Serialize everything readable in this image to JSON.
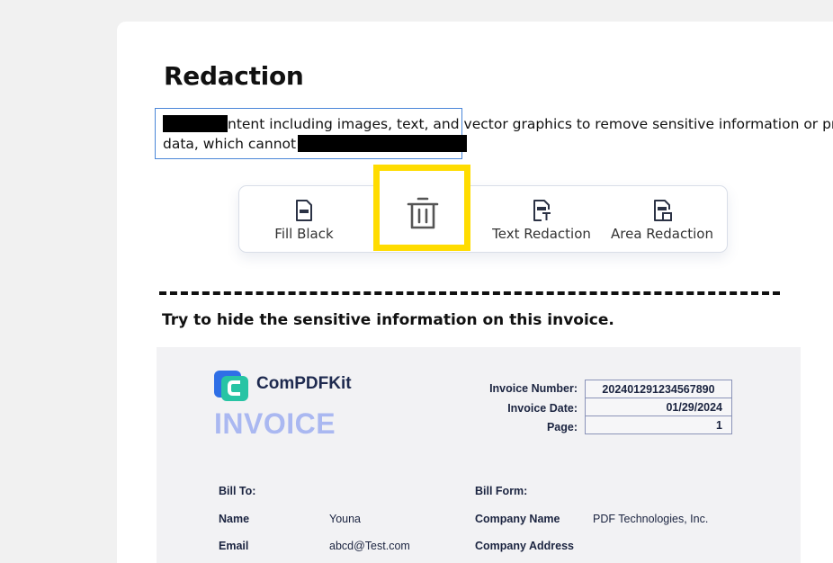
{
  "page": {
    "title": "Redaction",
    "paragraph": {
      "line1_text": "ntent including images, text, and vector graphics to remove sensitive information or private",
      "line2_text": "data, which cannot"
    }
  },
  "toolbar": {
    "items": [
      {
        "label": "Fill Black",
        "icon": "fill-black-icon"
      },
      {
        "label": "",
        "icon": "trash-icon"
      },
      {
        "label": "Text Redaction",
        "icon": "text-redaction-icon"
      },
      {
        "label": "Area Redaction",
        "icon": "area-redaction-icon"
      }
    ],
    "highlight_color": "#ffdc00"
  },
  "instructions": "Try to hide the sensitive information on this invoice.",
  "invoice": {
    "brand": "ComPDFKit",
    "heading": "INVOICE",
    "meta": [
      {
        "label": "Invoice Number:",
        "value": "202401291234567890"
      },
      {
        "label": "Invoice Date:",
        "value": "01/29/2024"
      },
      {
        "label": "Page:",
        "value": "1"
      }
    ],
    "bill_to": {
      "heading": "Bill To:",
      "name_label": "Name",
      "name_value": "Youna",
      "email_label": "Email",
      "email_value": "abcd@Test.com"
    },
    "bill_from": {
      "heading": "Bill Form:",
      "company_label": "Company Name",
      "company_value": "PDF Technologies, Inc.",
      "address_label": "Company Address"
    }
  },
  "colors": {
    "selection_border": "#4a86d8",
    "brand_blue": "#2f6fe6",
    "brand_teal": "#27c4a4",
    "invoice_word": "#aab8f1"
  }
}
